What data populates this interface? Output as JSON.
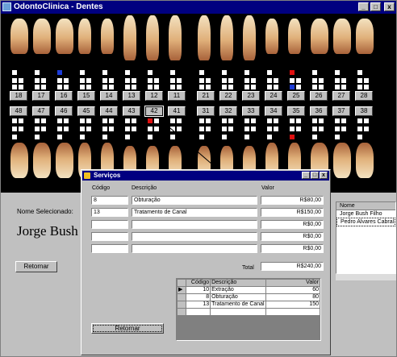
{
  "main_window": {
    "title": "OdontoClinica - Dentes",
    "btn_minimize": "_",
    "btn_maximize": "□",
    "btn_close": "x"
  },
  "teeth": {
    "upper_numbers": [
      "18",
      "17",
      "16",
      "15",
      "14",
      "13",
      "12",
      "11",
      "21",
      "22",
      "23",
      "24",
      "25",
      "26",
      "27",
      "28"
    ],
    "lower_numbers": [
      "48",
      "47",
      "46",
      "45",
      "44",
      "43",
      "42",
      "41",
      "31",
      "32",
      "33",
      "34",
      "35",
      "36",
      "37",
      "38"
    ],
    "selected_tooth": "42"
  },
  "patient": {
    "selected_label": "Nome Selecionado:",
    "selected_name": "Jorge Bush",
    "return_button": "Retornar"
  },
  "patients_list": {
    "header": "Nome",
    "rows": [
      "Jorge Bush Filho",
      "Pedro Alvares Cabral"
    ]
  },
  "services_dialog": {
    "title": "Serviços",
    "col_code": "Código",
    "col_desc": "Descrição",
    "col_value": "Valor",
    "rows": [
      {
        "code": "8",
        "desc": "Obturação",
        "value": "R$80,00"
      },
      {
        "code": "13",
        "desc": "Tratamento de Canal",
        "value": "R$150,00"
      },
      {
        "code": "",
        "desc": "",
        "value": "R$0,00"
      },
      {
        "code": "",
        "desc": "",
        "value": "R$0,00"
      },
      {
        "code": "",
        "desc": "",
        "value": "R$0,00"
      }
    ],
    "total_label": "Total",
    "total_value": "R$240,00",
    "return_button": "Retornar",
    "grid": {
      "headers": [
        "Código",
        "Descrição",
        "Valor"
      ],
      "rows": [
        {
          "code": "10",
          "desc": "Extração",
          "value": "60"
        },
        {
          "code": "8",
          "desc": "Obturação",
          "value": "80"
        },
        {
          "code": "13",
          "desc": "Tratamento de Canal",
          "value": "150"
        }
      ]
    }
  }
}
